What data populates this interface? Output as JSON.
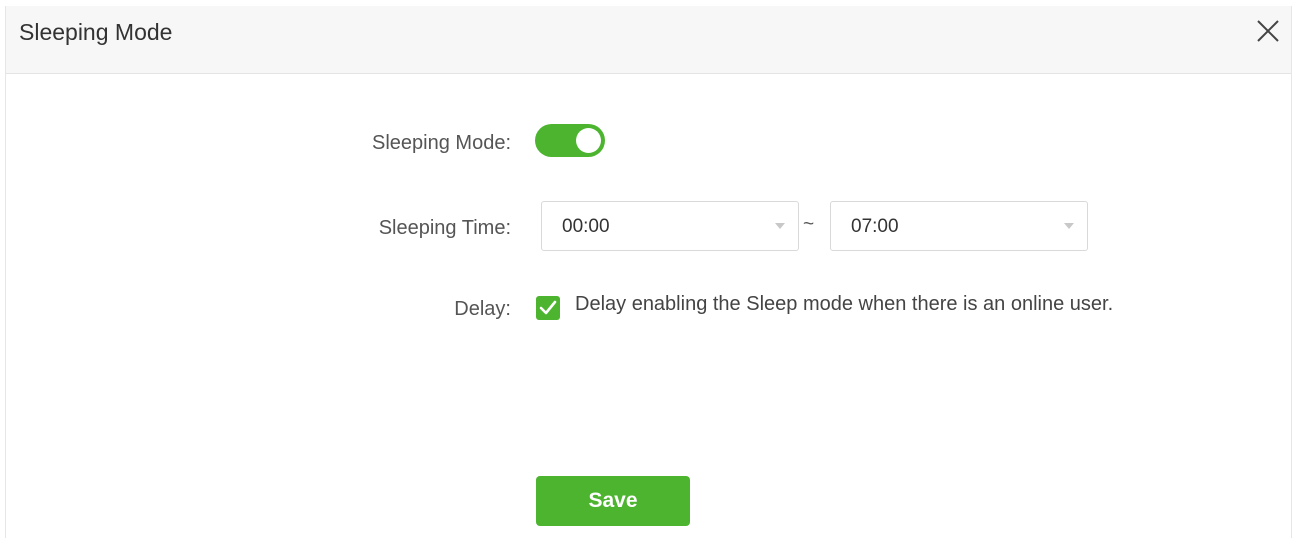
{
  "dialog": {
    "title": "Sleeping Mode",
    "close_icon": "close-icon"
  },
  "form": {
    "sleeping_mode": {
      "label": "Sleeping Mode:",
      "enabled": true
    },
    "sleeping_time": {
      "label": "Sleeping Time:",
      "start": "00:00",
      "separator": "~",
      "end": "07:00"
    },
    "delay": {
      "label": "Delay:",
      "checked": true,
      "text": "Delay enabling the Sleep mode when there is an online user."
    }
  },
  "actions": {
    "save_label": "Save"
  },
  "colors": {
    "accent": "#4cb42f",
    "header_bg": "#f7f7f7"
  }
}
